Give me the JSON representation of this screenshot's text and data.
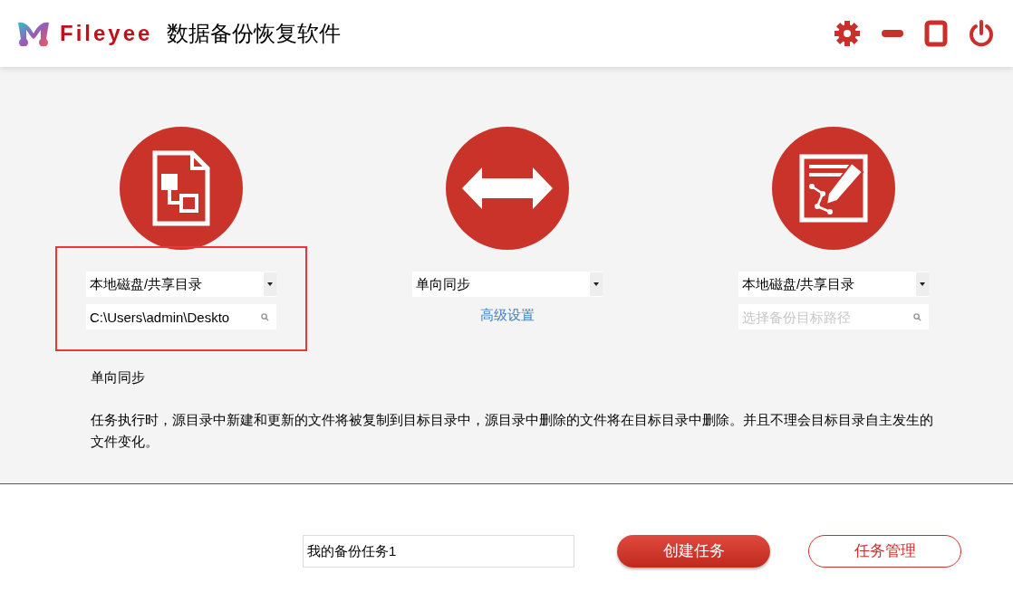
{
  "header": {
    "brand": "Fileyee",
    "title": "数据备份恢复软件"
  },
  "panels": [
    {
      "kind": "source",
      "highlighted": true,
      "type_select": {
        "value": "本地磁盘/共享目录"
      },
      "path_field": {
        "value": "C:\\Users\\admin\\Deskto"
      }
    },
    {
      "kind": "mode",
      "highlighted": false,
      "mode_select": {
        "value": "单向同步"
      },
      "link": "高级设置"
    },
    {
      "kind": "target",
      "highlighted": false,
      "type_select": {
        "value": "本地磁盘/共享目录"
      },
      "path_field": {
        "placeholder": "选择备份目标路径"
      }
    }
  ],
  "description": {
    "title": "单向同步",
    "text": "任务执行时，源目录中新建和更新的文件将被复制到目标目录中，源目录中删除的文件将在目标目录中删除。并且不理会目标目录自主发生的文件变化。"
  },
  "footer": {
    "task_name": {
      "value": "我的备份任务1"
    },
    "buttons": [
      {
        "label": "创建任务",
        "kind": "primary"
      },
      {
        "label": "任务管理",
        "kind": "outline"
      }
    ]
  }
}
